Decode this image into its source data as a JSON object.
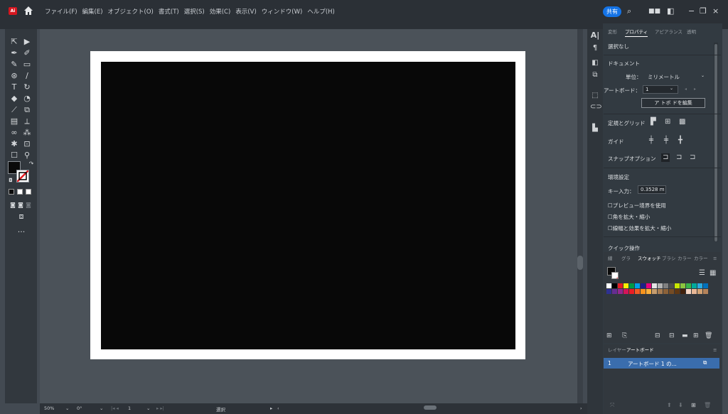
{
  "app": {
    "logo": "Ai"
  },
  "menubar": {
    "items": [
      "ファイル(F)",
      "編集(E)",
      "オブジェクト(O)",
      "書式(T)",
      "選択(S)",
      "効果(C)",
      "表示(V)",
      "ウィンドウ(W)",
      "ヘルプ(H)"
    ],
    "share_label": "共有"
  },
  "statusbar": {
    "zoom": "50%",
    "rotation": "0°",
    "artboard_number": "1",
    "mode": "選択"
  },
  "panel": {
    "tabs": [
      "変形",
      "プロパティ",
      "アピアランス",
      "透明"
    ],
    "active_tab": "プロパティ",
    "selection": "選択なし",
    "document_header": "ドキュメント",
    "unit_label": "単位：",
    "unit_value": "ミリメートル",
    "artboard_label": "アートボード：",
    "artboard_value": "1",
    "edit_artboard_button": "ア トボ ドを編集",
    "rulers_grid_label": "定規とグリッド",
    "guides_label": "ガイド",
    "snap_label": "スナップオプション",
    "preferences_header": "環境設定",
    "key_input_label": "キー入力：",
    "key_input_value": "0.3528 m",
    "checkbox_preview": "プレビュー境界を使用",
    "checkbox_corners": "角を拡大・縮小",
    "checkbox_strokes": "線幅と効果を拡大・縮小",
    "quick_actions_header": "クイック操作"
  },
  "swatches_panel": {
    "tabs": [
      "線",
      "グラ",
      "スウォッチ",
      "ブラシ",
      "カラー",
      "カラー"
    ],
    "active_tab": "スウォッチ",
    "colors": [
      "#ffffff",
      "#000000",
      "#e31e24",
      "#ffed00",
      "#009a44",
      "#00a0e9",
      "#1d2088",
      "#e4007f",
      "#e5e5e5",
      "#b3b3b3",
      "#808080",
      "#4d4d4d",
      "#c8e600",
      "#8cc63f",
      "#39b54a",
      "#00a99d",
      "#29abe2",
      "#0071bc",
      "#2e3192",
      "#662d91",
      "#93278f",
      "#d4145a",
      "#ed1c24",
      "#f15a24",
      "#f7931e",
      "#fbb03b",
      "#c69c6d",
      "#a67c52",
      "#8c6239",
      "#754c24",
      "#603813",
      "#42210b",
      "#f7d7c4",
      "#e8b796",
      "#d4a373",
      "#b5835a"
    ]
  },
  "layers_panel": {
    "tabs": [
      "レイヤー",
      "アートボード"
    ],
    "active_tab": "アートボード",
    "rows": [
      {
        "number": "1",
        "name": "アートボード 1 の..."
      }
    ]
  }
}
